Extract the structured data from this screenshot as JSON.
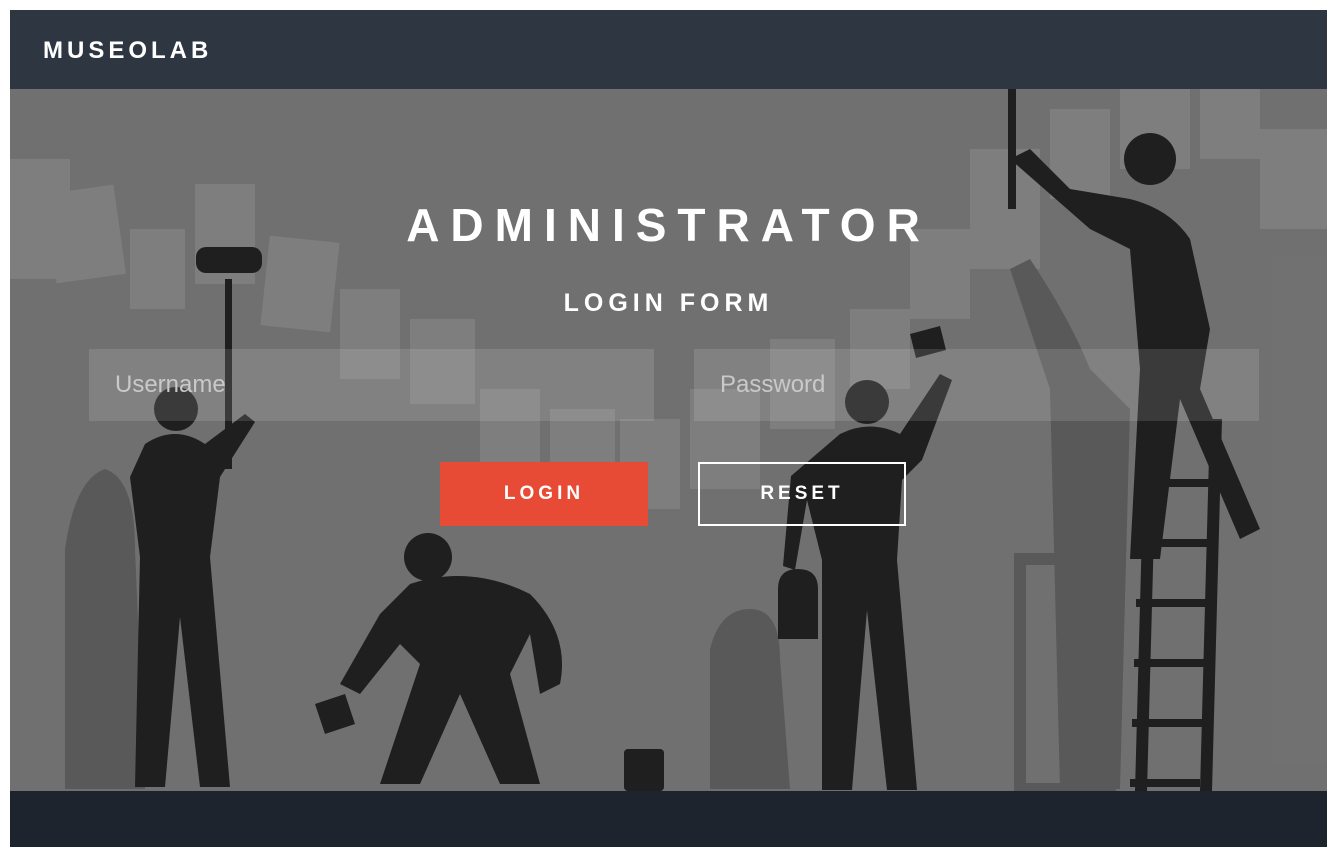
{
  "header": {
    "brand": "MUSEOLAB"
  },
  "hero": {
    "title": "ADMINISTRATOR",
    "subtitle": "LOGIN FORM"
  },
  "form": {
    "username_placeholder": "Username",
    "password_placeholder": "Password",
    "login_label": "LOGIN",
    "reset_label": "RESET"
  },
  "colors": {
    "header_bg": "#2e3642",
    "footer_bg": "#1e242d",
    "accent": "#e84b35",
    "hero_bg": "#7a7a7a"
  }
}
